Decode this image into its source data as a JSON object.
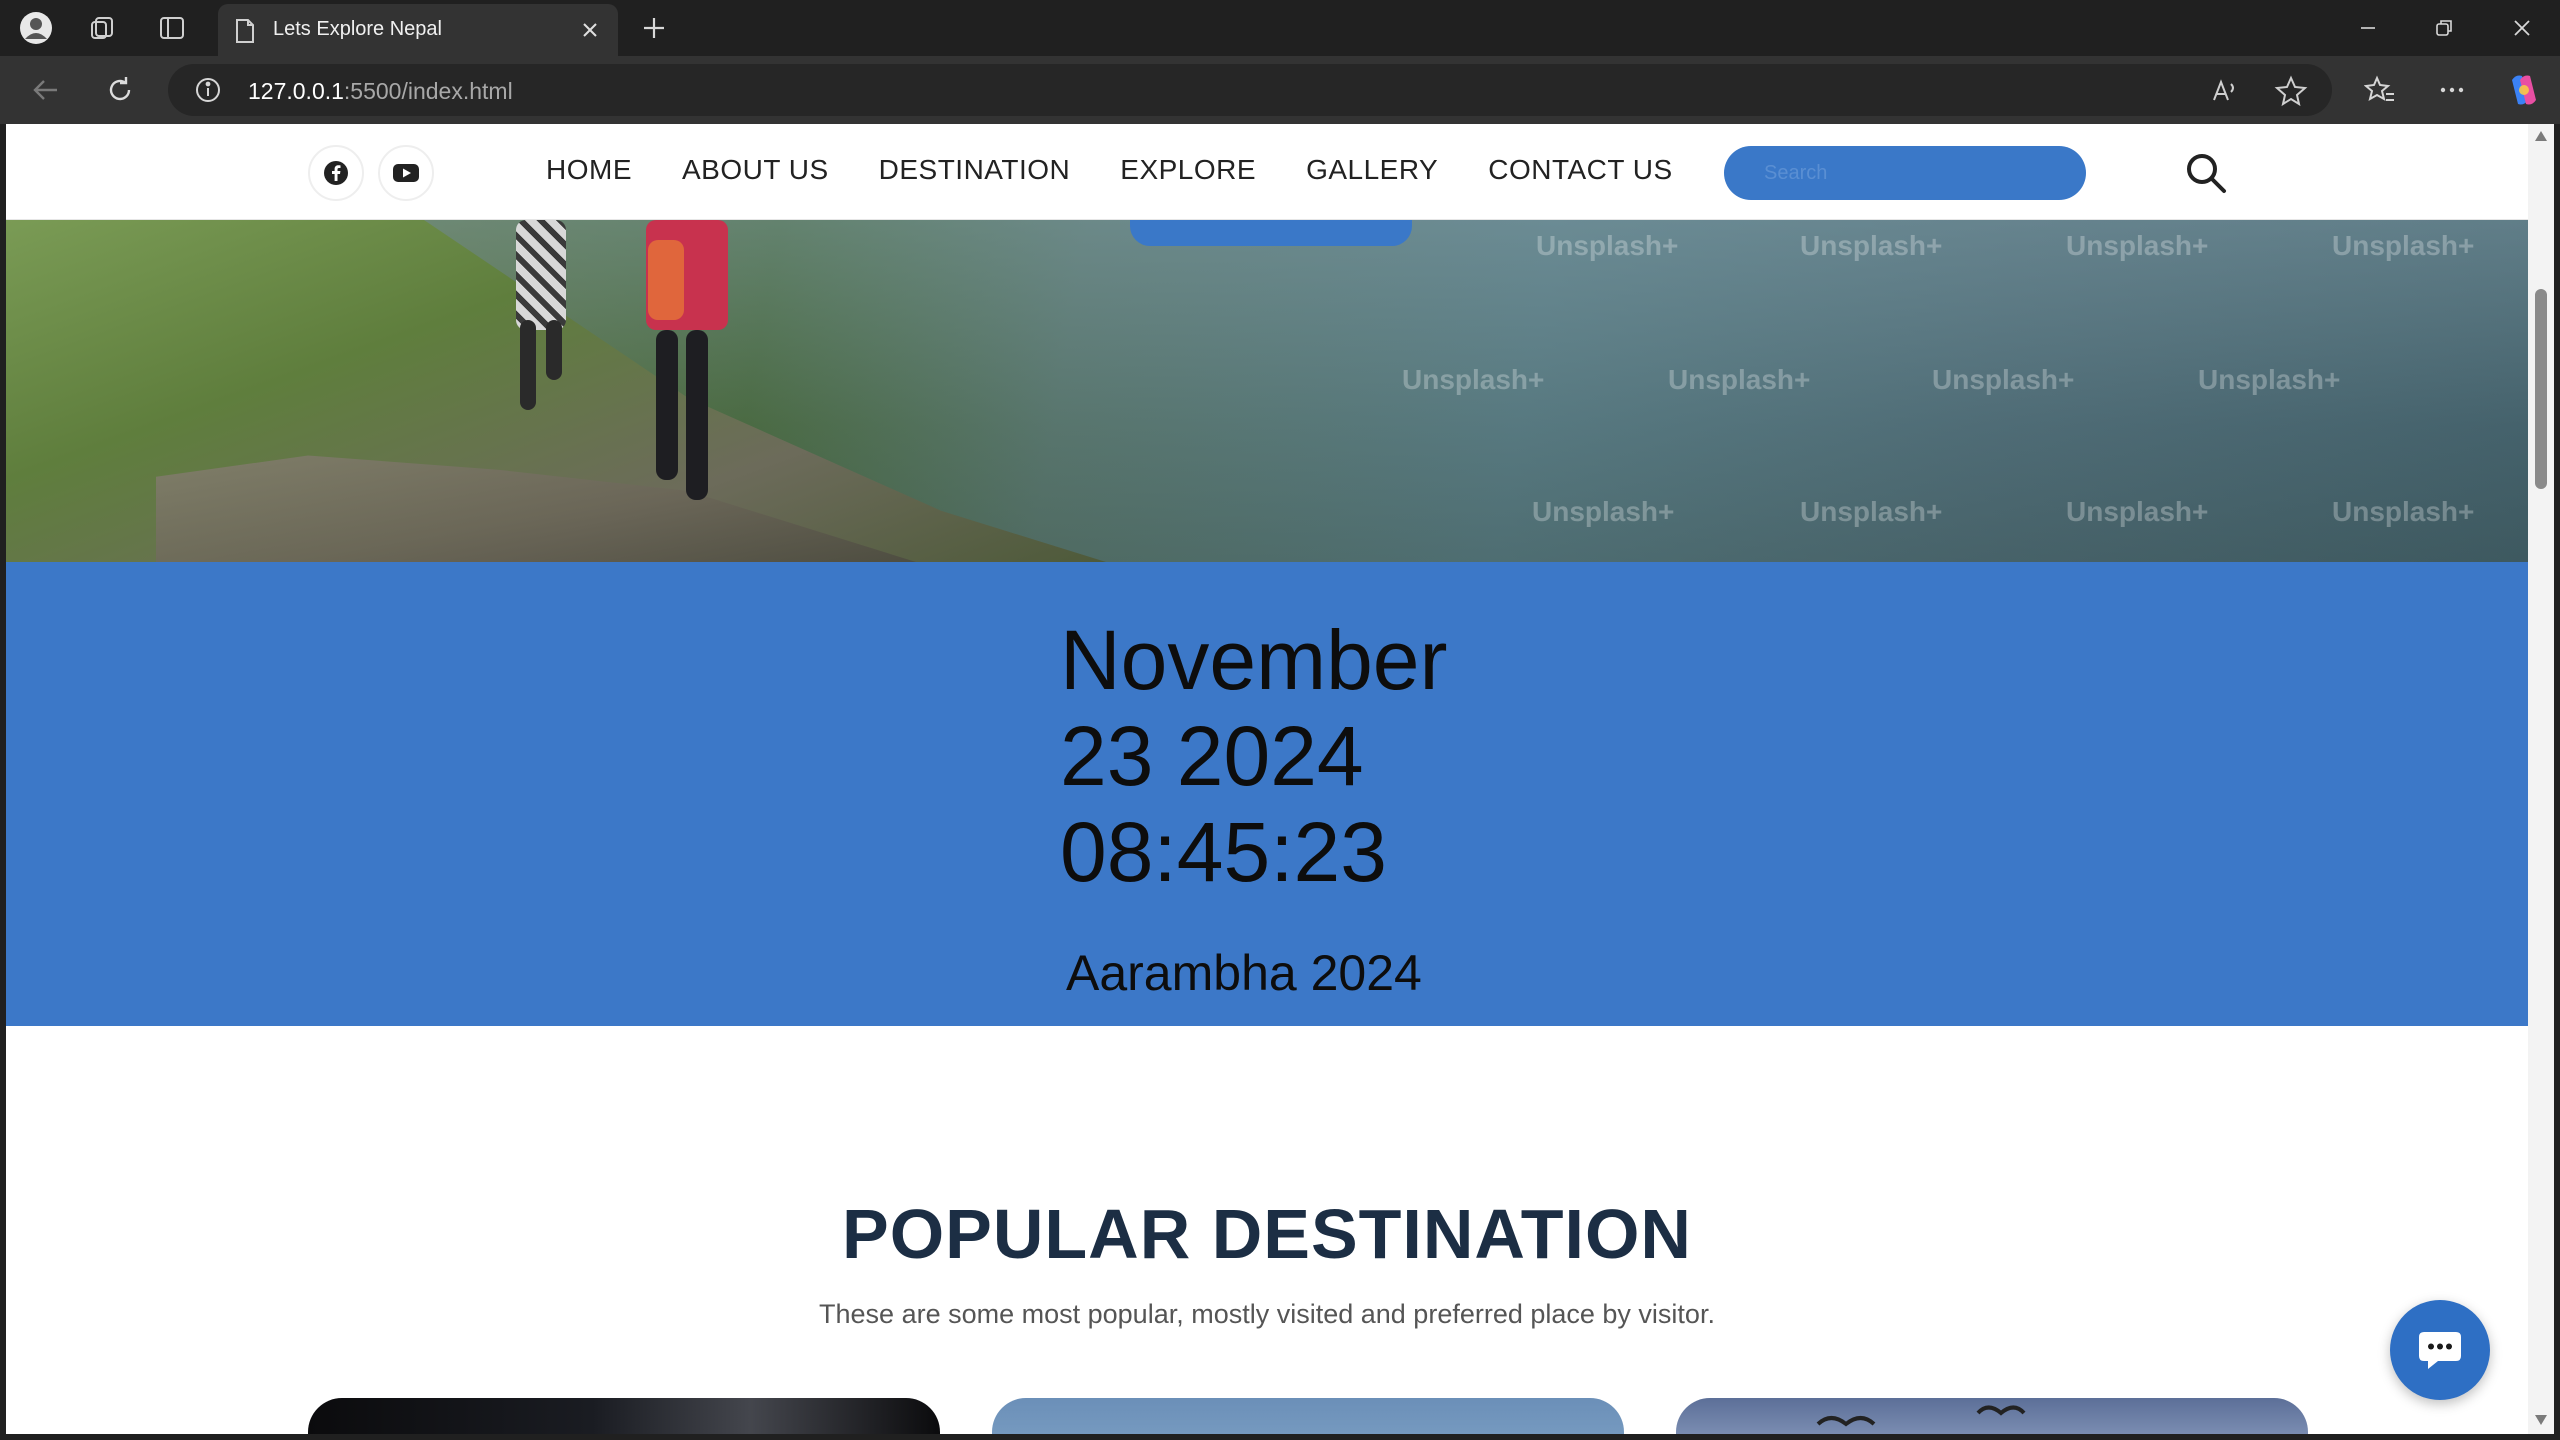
{
  "browser": {
    "tab_title": "Lets Explore Nepal",
    "url_host": "127.0.0.1",
    "url_rest": ":5500/index.html"
  },
  "site": {
    "nav": [
      "HOME",
      "ABOUT US",
      "DESTINATION",
      "EXPLORE",
      "GALLERY",
      "CONTACT US"
    ],
    "search_placeholder": "Search",
    "watermark": "Unsplash+"
  },
  "clock": {
    "line1": "November",
    "line2": "23 2024",
    "line3": "08:45:23",
    "event": "Aarambha 2024"
  },
  "destination": {
    "title": "POPULAR DESTINATION",
    "subtitle": "These are some most popular, mostly visited and preferred place by visitor."
  },
  "colors": {
    "accent": "#3c78c8",
    "heading": "#1c2e44"
  }
}
